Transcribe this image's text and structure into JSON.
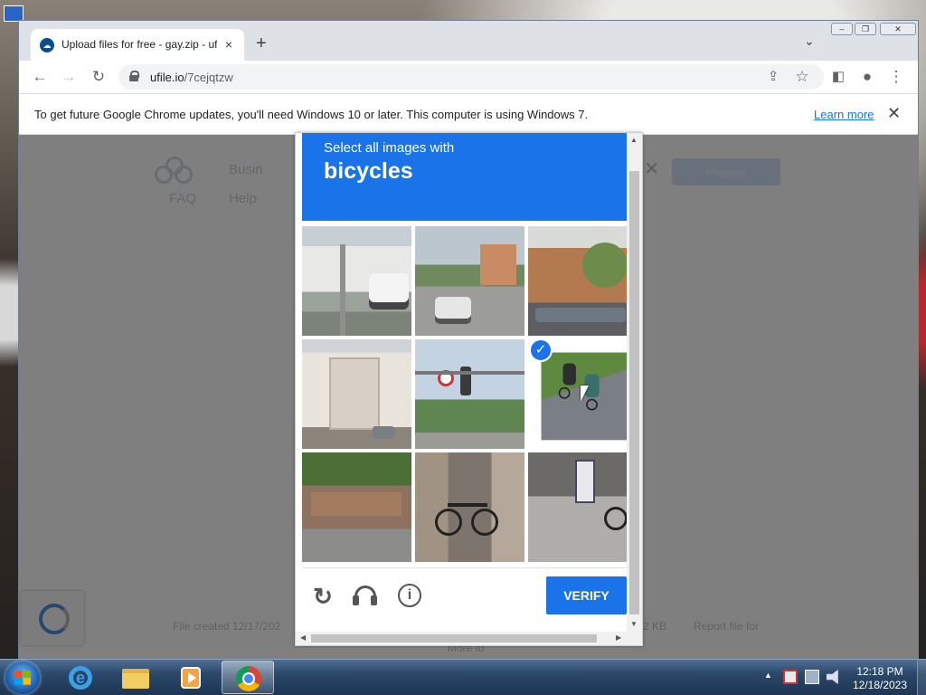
{
  "browser": {
    "tab_title": "Upload files for free - gay.zip - ufile.io",
    "tab_close": "×",
    "new_tab": "+",
    "url_host": "ufile.io",
    "url_path": "/7cejqtzw"
  },
  "infobar": {
    "message": "To get future Google Chrome updates, you'll need Windows 10 or later. This computer is using Windows 7.",
    "learn_more": "Learn more",
    "close": "✕"
  },
  "page": {
    "nav_business": "Busin",
    "nav_faq": "FAQ",
    "nav_help": "Help",
    "register": "Register",
    "footer_created": "File created 12/17/202",
    "footer_size": "2 KB",
    "footer_report": "Report file for",
    "footer_more": "More to"
  },
  "captcha": {
    "instruction": "Select all images with",
    "object": "bicycles",
    "verify_label": "VERIFY",
    "checkmark": "✓",
    "reload_glyph": "↻",
    "info_glyph": "i",
    "tiles": [
      {
        "desc": "street with white car",
        "selected": false
      },
      {
        "desc": "road with car",
        "selected": false
      },
      {
        "desc": "buildings and cars",
        "selected": false
      },
      {
        "desc": "house on corner",
        "selected": false
      },
      {
        "desc": "traffic signs and trees",
        "selected": false
      },
      {
        "desc": "cyclists on road",
        "selected": true
      },
      {
        "desc": "garden and pavement",
        "selected": false
      },
      {
        "desc": "parked bicycles",
        "selected": false
      },
      {
        "desc": "shop front with bicycle",
        "selected": false
      }
    ]
  },
  "taskbar": {
    "time": "12:18 PM",
    "date": "12/18/2023"
  },
  "colors": {
    "accent": "#1a73e8",
    "taskbar": "#2a4869"
  }
}
